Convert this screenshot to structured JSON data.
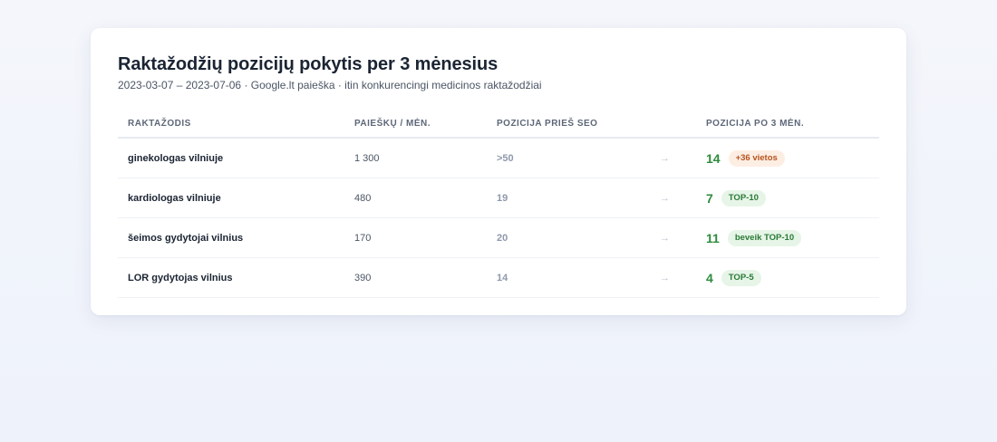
{
  "report": {
    "title": "Raktažodžių pozicijų pokytis per 3 mėnesius",
    "subtitle": "2023-03-07 – 2023-07-06 · Google.lt paieška · itin konkurencingi medicinos raktažodžiai"
  },
  "table": {
    "headers": {
      "keyword": "RAKTAŽODIS",
      "volume": "PAIEŠKŲ / MĖN.",
      "before": "POZICIJA PRIEŠ SEO",
      "after": "POZICIJA PO 3 MĖN."
    },
    "arrow_glyph": "→",
    "rows": [
      {
        "keyword": "ginekologas vilniuje",
        "volume": "1 300",
        "before": ">50",
        "after": "14",
        "badge": "+36 vietos",
        "badge_kind": "warn"
      },
      {
        "keyword": "kardiologas vilniuje",
        "volume": "480",
        "before": "19",
        "after": "7",
        "badge": "TOP-10",
        "badge_kind": "good"
      },
      {
        "keyword": "šeimos gydytojai vilnius",
        "volume": "170",
        "before": "20",
        "after": "11",
        "badge": "beveik TOP-10",
        "badge_kind": "good"
      },
      {
        "keyword": "LOR gydytojas vilnius",
        "volume": "390",
        "before": "14",
        "after": "4",
        "badge": "TOP-5",
        "badge_kind": "good"
      }
    ]
  },
  "colors": {
    "improvement_green": "#2e8b3e",
    "badge_warn_bg": "#fdeee3",
    "badge_warn_text": "#b5541d",
    "badge_good_bg": "#e6f5e7",
    "badge_good_text": "#2b7a37",
    "muted_position": "#8e99ab"
  }
}
